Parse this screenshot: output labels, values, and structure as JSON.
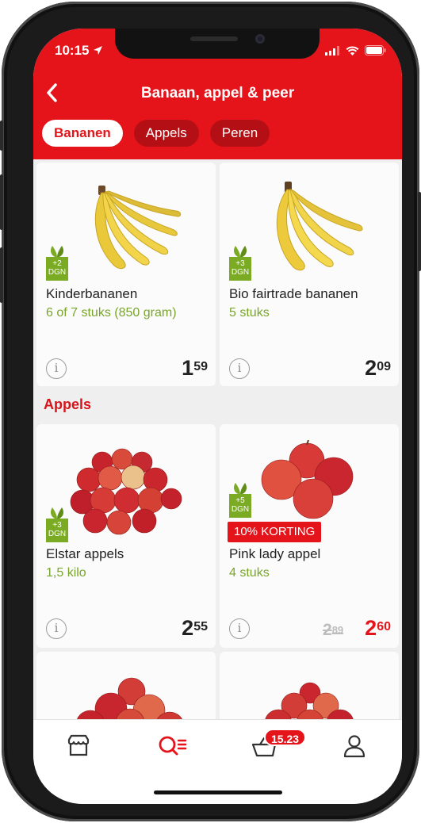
{
  "status": {
    "time": "10:15"
  },
  "header": {
    "title": "Banaan, appel & peer"
  },
  "tabs": [
    {
      "label": "Bananen",
      "active": true
    },
    {
      "label": "Appels",
      "active": false
    },
    {
      "label": "Peren",
      "active": false
    }
  ],
  "products_bananen": [
    {
      "name": "Kinderbananen",
      "amount": "6 of 7 stuks (850 gram)",
      "dgn": "+2",
      "dgn_unit": "DGN",
      "price_whole": "1",
      "price_cents": "59"
    },
    {
      "name": "Bio fairtrade bananen",
      "amount": "5 stuks",
      "dgn": "+3",
      "dgn_unit": "DGN",
      "price_whole": "2",
      "price_cents": "09"
    }
  ],
  "section_appels": "Appels",
  "products_appels": [
    {
      "name": "Elstar appels",
      "amount": "1,5 kilo",
      "dgn": "+3",
      "dgn_unit": "DGN",
      "price_whole": "2",
      "price_cents": "55"
    },
    {
      "name": "Pink lady appel",
      "amount": "4 stuks",
      "dgn": "+5",
      "dgn_unit": "DGN",
      "discount": "10% KORTING",
      "old_price_whole": "2",
      "old_price_cents": "89",
      "price_whole": "2",
      "price_cents": "60"
    }
  ],
  "tabbar": {
    "basket_badge": "15.23"
  },
  "colors": {
    "brand_red": "#e5141a",
    "green": "#79a52a",
    "dgn_green": "#7bab22"
  },
  "icons": [
    "back-arrow-icon",
    "signal-icon",
    "wifi-icon",
    "battery-icon",
    "info-icon",
    "store-icon",
    "search-list-icon",
    "basket-icon",
    "user-icon",
    "leaf-icon"
  ]
}
